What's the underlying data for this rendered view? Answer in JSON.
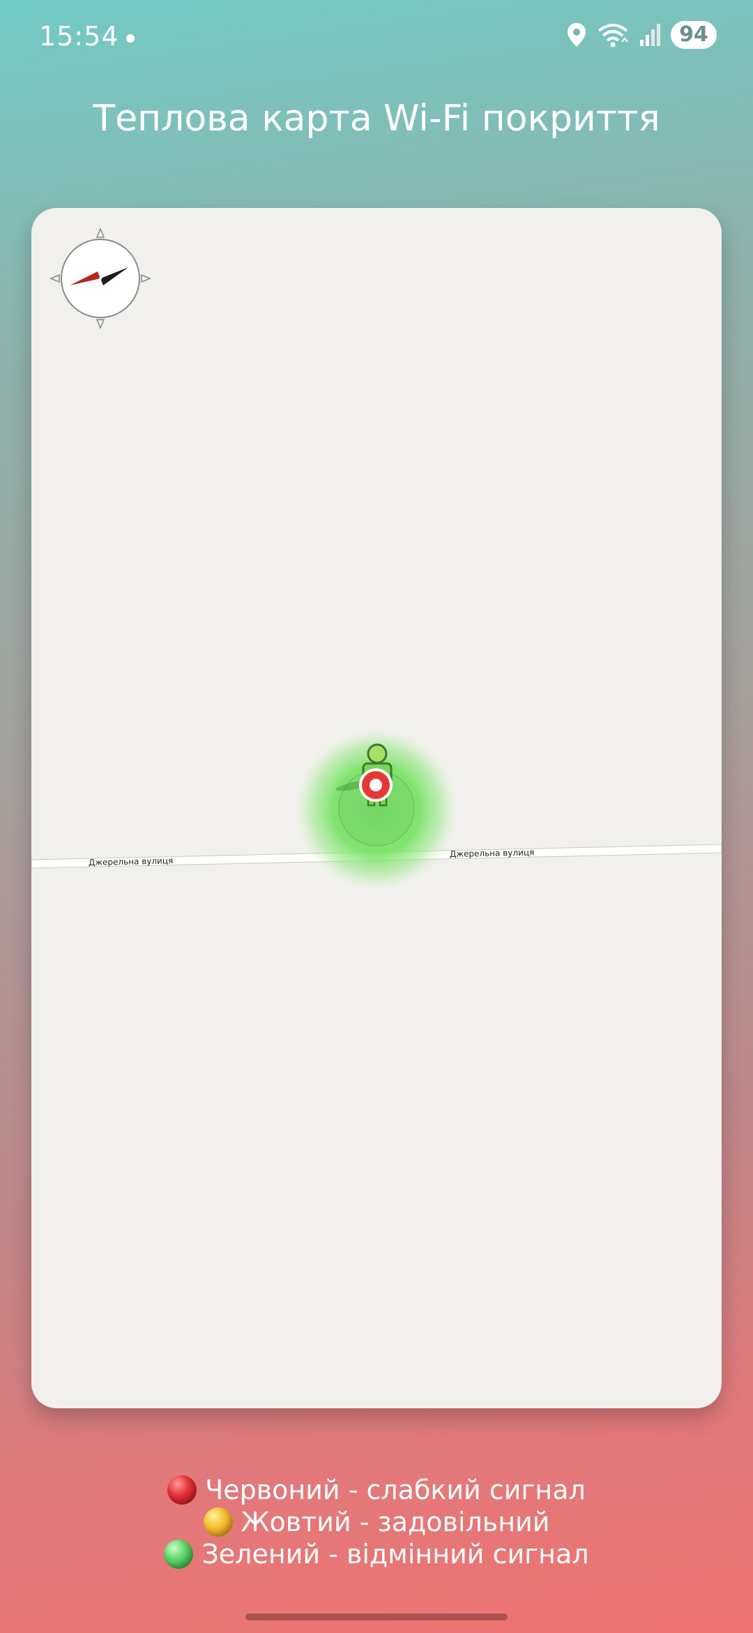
{
  "status_bar": {
    "time": "15:54",
    "battery": "94",
    "icons": [
      "location-icon",
      "wifi-icon",
      "signal-icon",
      "battery-icon"
    ]
  },
  "title": "Теплова карта Wi-Fi покриття",
  "map": {
    "road_name_left": "Джерельна вулиця",
    "road_name_right": "Джерельна вулиця",
    "heat_color": "#5ee04a",
    "marker_color": "#e53935",
    "background_color": "#f1f0ec"
  },
  "legend": {
    "items": [
      {
        "label": "Червоний - слабкий сигнал",
        "color": "#e8333a"
      },
      {
        "label": "Жовтий - задовільний",
        "color": "#f5c030"
      },
      {
        "label": "Зелений - відмінний сигнал",
        "color": "#5fd56a"
      }
    ]
  }
}
